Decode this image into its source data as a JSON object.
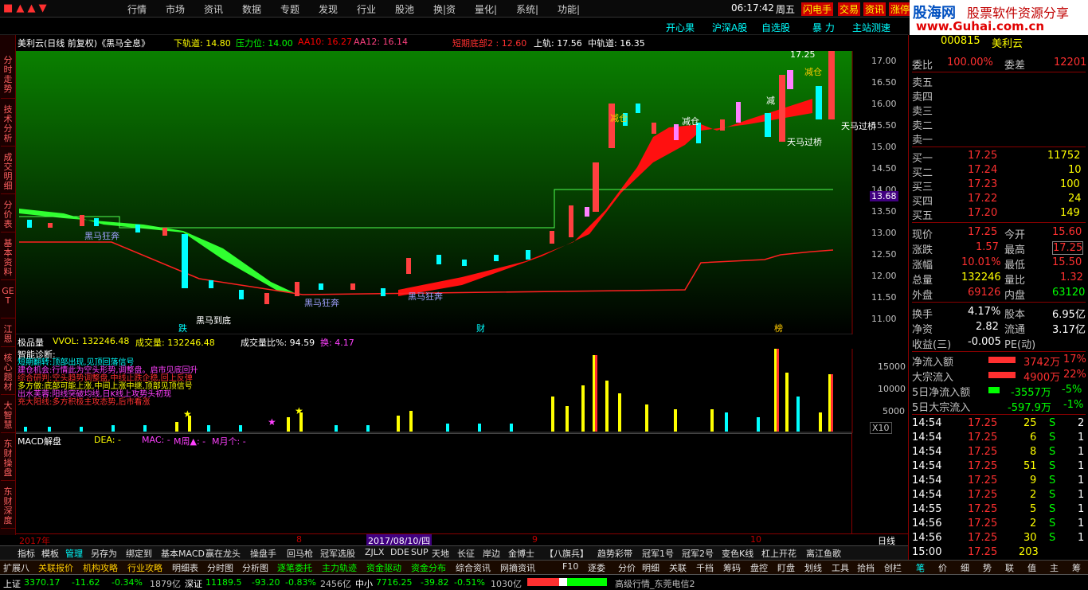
{
  "menu": {
    "items": [
      "行情",
      "市场",
      "资讯",
      "数据",
      "专题",
      "发现",
      "行业",
      "股池",
      "换|资",
      "量化|",
      "系统|",
      "功能|"
    ],
    "time": "06:17:42",
    "weekday": "周五",
    "btns": [
      "闪电手",
      "交易",
      "资讯",
      "涨停"
    ]
  },
  "brand": {
    "name": "股海网",
    "slogan": "股票软件资源分享",
    "url": "www.Guhai.com.cn"
  },
  "nav": [
    "开心果",
    "沪深A股",
    "自选股",
    "暴 力",
    "主站测速"
  ],
  "left_tabs": [
    "分时走势",
    "技术分析",
    "成交明细",
    "分价表",
    "基本资料",
    "GET",
    "江恩",
    "核心题材",
    "大智慧",
    "东财操盘",
    "东财深度"
  ],
  "chart": {
    "title": "美利云(日线 前复权)《黑马全息》",
    "ind": [
      {
        "t": "下轨道: 14.80",
        "c": "#ffff00"
      },
      {
        "t": "压力位: 14.00",
        "c": "#00ff00"
      },
      {
        "t": "AA10: 16.27",
        "c": "#ff0000"
      },
      {
        "t": "AA12: 16.14",
        "c": "#ff4080"
      },
      {
        "t": "短期底部2 : 12.60",
        "c": "#ff3030"
      },
      {
        "t": "上轨: 17.56",
        "c": "#ffffff"
      },
      {
        "t": "中轨道: 16.35",
        "c": "#ffffff"
      }
    ],
    "yticks": [
      "17.00",
      "16.50",
      "16.00",
      "15.50",
      "15.00",
      "14.50",
      "14.00",
      "13.50",
      "13.00",
      "12.50",
      "12.00",
      "11.50",
      "11.00"
    ],
    "price_tag": "13.68",
    "ann_top": "17.25",
    "ann": [
      "黑马狂奔",
      "黑马狂奔",
      "黑马狂奔",
      "天马过桥",
      "天马过桥",
      "减仓",
      "减仓",
      "减仓",
      "减",
      "黑马到底"
    ],
    "markers": [
      "跌",
      "财",
      "榜"
    ]
  },
  "vol": {
    "title": "极品量",
    "vvol": "VVOL: 132246.48",
    "cj": "成交量: 132246.48",
    "ratio": "成交量比%: 94.59",
    "huan": "换: 4.17",
    "yticks": [
      "15000",
      "10000",
      "5000"
    ],
    "x10": "X10",
    "diag_title": "智能诊断:",
    "diag": [
      "短期翻转:顶部出现,见顶回落信号",
      "建仓机会:行情此为空头形势,调整盘。启市见底回升",
      "综合研判:空头趋势调整盘,中线止跌企稳,回上反弹",
      "多方做:底部可能上涨,中间上涨中继,顶部见顶信号",
      "出水芙蓉:阳线突破均线,日K线上攻势头初现",
      "充大阳线:多方积极主攻态势,后市看涨"
    ]
  },
  "macd": {
    "title": "MACD解盘",
    "dea": "DEA: -",
    "mac": "MAC: -",
    "other": "M周▲: -",
    "month": "M月个: -"
  },
  "dates": {
    "d1": "2017年",
    "d2": "8",
    "cursor": "2017/08/10/四",
    "d3": "9",
    "d4": "10",
    "rtxt": "日线"
  },
  "quote": {
    "code": "000815",
    "name": "美利云",
    "weibi": "100.00%",
    "weicha": "12201",
    "sells": [
      [
        "卖五",
        "",
        ""
      ],
      [
        "卖四",
        "",
        ""
      ],
      [
        "卖三",
        "",
        ""
      ],
      [
        "卖二",
        "",
        ""
      ],
      [
        "卖一",
        "",
        ""
      ]
    ],
    "buys": [
      [
        "买一",
        "17.25",
        "11752"
      ],
      [
        "买二",
        "17.24",
        "10"
      ],
      [
        "买三",
        "17.23",
        "100"
      ],
      [
        "买四",
        "17.22",
        "24"
      ],
      [
        "买五",
        "17.20",
        "149"
      ]
    ],
    "stats": [
      [
        "现价",
        "17.25",
        "今开",
        "15.60"
      ],
      [
        "涨跌",
        "1.57",
        "最高",
        "17.25"
      ],
      [
        "涨幅",
        "10.01%",
        "最低",
        "15.50"
      ],
      [
        "总量",
        "132246",
        "量比",
        "1.32"
      ],
      [
        "外盘",
        "69126",
        "内盘",
        "63120"
      ],
      [
        "换手",
        "4.17%",
        "股本",
        "6.95亿"
      ],
      [
        "净资",
        "2.82",
        "流通",
        "3.17亿"
      ],
      [
        "收益(三)",
        "-0.005",
        "PE(动)",
        ""
      ]
    ],
    "flows": [
      [
        "净流入额",
        "3742万",
        "17%"
      ],
      [
        "大宗流入",
        "4900万",
        "22%"
      ],
      [
        "5日净流入额",
        "-3557万",
        "-5%"
      ],
      [
        "5日大宗流入",
        "-597.9万",
        "-1%"
      ]
    ],
    "ticks": [
      [
        "14:54",
        "17.25",
        "25",
        "S",
        "2"
      ],
      [
        "14:54",
        "17.25",
        "6",
        "S",
        "1"
      ],
      [
        "14:54",
        "17.25",
        "8",
        "S",
        "1"
      ],
      [
        "14:54",
        "17.25",
        "51",
        "S",
        "1"
      ],
      [
        "14:54",
        "17.25",
        "9",
        "S",
        "1"
      ],
      [
        "14:54",
        "17.25",
        "2",
        "S",
        "1"
      ],
      [
        "14:55",
        "17.25",
        "5",
        "S",
        "1"
      ],
      [
        "14:56",
        "17.25",
        "2",
        "S",
        "1"
      ],
      [
        "14:56",
        "17.25",
        "30",
        "S",
        "1"
      ],
      [
        "15:00",
        "17.25",
        "203",
        "",
        ""
      ]
    ]
  },
  "rtabs": [
    "笔",
    "价",
    "细",
    "势",
    "联",
    "值",
    "主",
    "筹"
  ],
  "toolbar1": [
    "指标",
    "模板",
    "管理",
    "另存为",
    "绑定到",
    "基本MACD",
    "赢在龙头",
    "操盘手",
    "回马枪",
    "冠军选股",
    "ZJLX",
    "DDE",
    "SUP",
    "天地",
    "长征",
    "岸边",
    "金博士",
    "【八旗兵】",
    "趋势彩带",
    "冠军1号",
    "冠军2号",
    "变色K线",
    "杠上开花",
    "离江鱼歌"
  ],
  "toolbar2": [
    "扩展八",
    "关联报价",
    "机构攻略",
    "行业攻略",
    "明细表",
    "分时图",
    "分析图",
    "逐笔委托",
    "主力轨迹",
    "资金驱动",
    "资金分布",
    "综合资讯",
    "网摘资讯",
    "F10",
    "逐委",
    "分价",
    "明细",
    "关联",
    "千档",
    "筹码",
    "盘控",
    "盯盘",
    "划线",
    "工具",
    "拾档",
    "创栏"
  ],
  "status": {
    "sh": "上证",
    "sh_v": "3370.17",
    "sh_c": "-11.62",
    "sh_p": "-0.34%",
    "sh_a": "1879亿",
    "sz": "深证",
    "sz_v": "11189.5",
    "sz_c": "-93.20",
    "sz_p": "-0.83%",
    "sz_a": "2456亿",
    "zx": "中小",
    "zx_v": "7716.25",
    "zx_c": "-39.82",
    "zx_p": "-0.51%",
    "zx_a": "1030亿",
    "server": "高级行情_东莞电信2"
  }
}
